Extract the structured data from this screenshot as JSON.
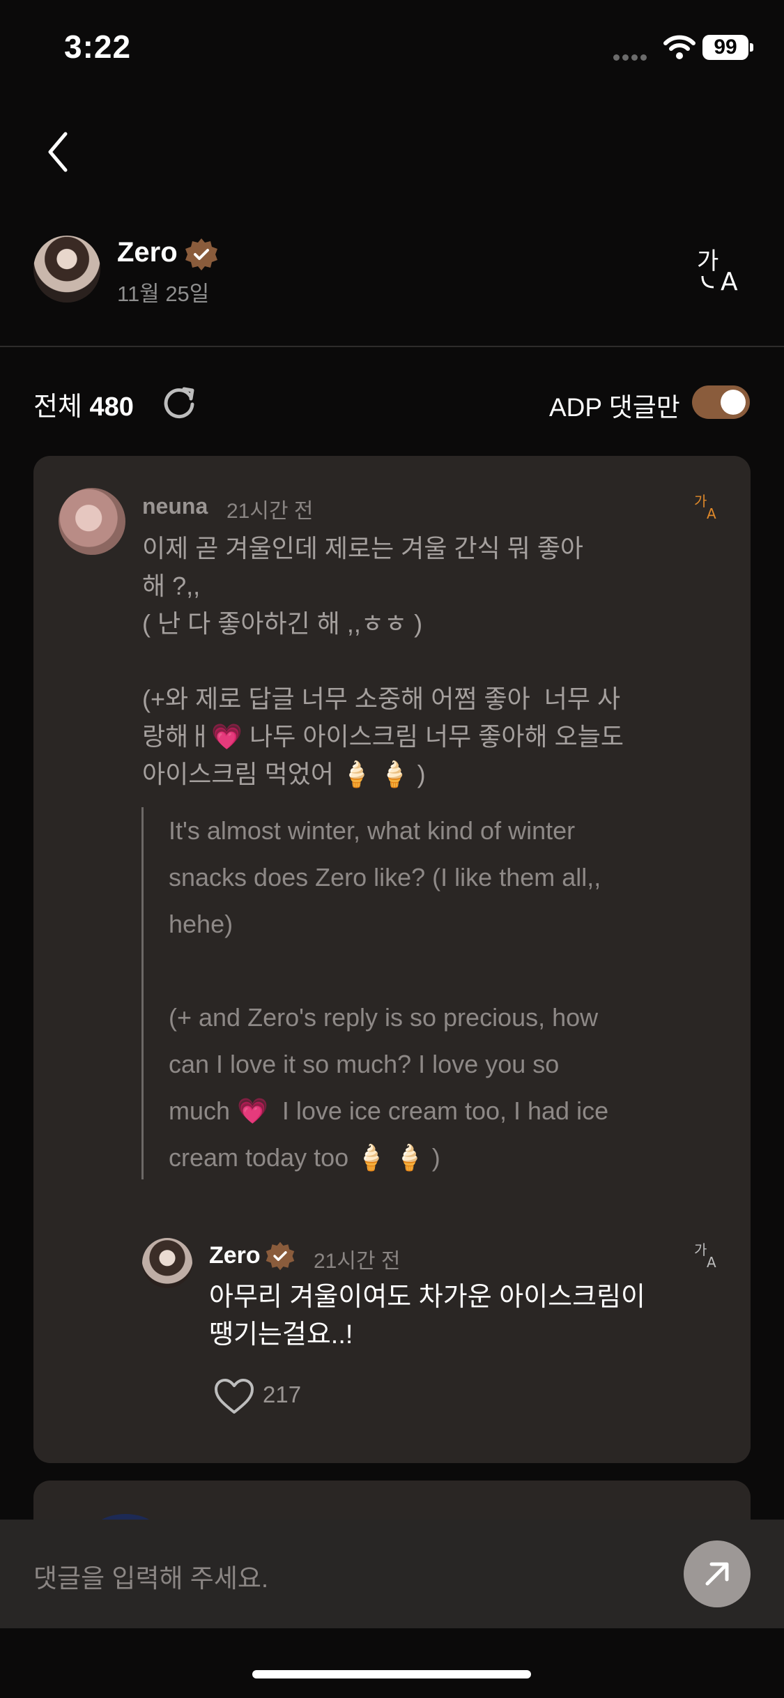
{
  "status_bar": {
    "time": "3:22",
    "battery": "99"
  },
  "header": {
    "name": "Zero",
    "date": "11월 25일"
  },
  "comments_header": {
    "total_label": "전체",
    "total_count": "480",
    "filter_label": "ADP 댓글만",
    "filter_on": true
  },
  "comment": {
    "user": "neuna",
    "time": "21시간 전",
    "text": "이제 곧 겨울인데 제로는 겨울 간식 뭐 좋아\n해 ?,,\n( 난 다 좋아하긴 해 ,,ㅎㅎ )\n\n(+와 제로 답글 너무 소중해 어쩜 좋아  너무 사\n랑해ㅐ💗 나두 아이스크림 너무 좋아해 오늘도\n아이스크림 먹었어 🍦 🍦 )",
    "translation": "It's almost winter, what kind of winter\nsnacks does Zero like? (I like them all,,\nhehe)\n\n(+ and Zero's reply is so precious, how\ncan I love it so much? I love you so\nmuch 💗  I love ice cream too, I had ice\ncream today too 🍦 🍦 )"
  },
  "reply": {
    "user": "Zero",
    "time": "21시간 전",
    "text": "아무리 겨울이여도 차가운 아이스크림이\n땡기는걸요..!",
    "likes": "217"
  },
  "input": {
    "placeholder": "댓글을 입력해 주세요."
  },
  "colors": {
    "accent": "#8a5c3c",
    "translate_accent": "#e0892a",
    "card": "#2a2624"
  }
}
